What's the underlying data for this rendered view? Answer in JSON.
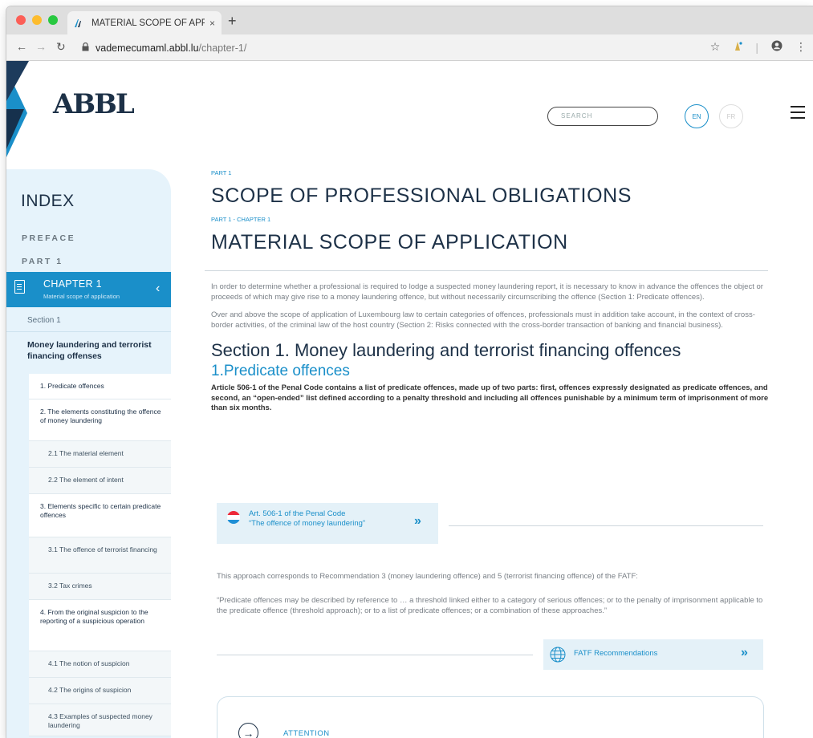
{
  "browser": {
    "tab_title": "MATERIAL SCOPE OF APPLICA",
    "tab_close": "×",
    "new_tab": "+",
    "url_host": "vademecumaml.abbl.lu",
    "url_path": "/chapter-1/"
  },
  "header": {
    "logo_text": "ABBL",
    "search_placeholder": "SEARCH",
    "lang_en": "EN",
    "lang_fr": "FR"
  },
  "sidebar": {
    "title": "INDEX",
    "preface": "PREFACE",
    "part": "PART 1",
    "chapter_title": "CHAPTER 1",
    "chapter_subtitle": "Material scope of application",
    "section_label": "Section 1",
    "section_title": "Money laundering and terrorist financing offenses",
    "items": [
      {
        "label": "1. Predicate offences",
        "level": 1
      },
      {
        "label": "2. The elements constituting the offence of money laundering",
        "level": 1
      },
      {
        "label": "2.1 The material element",
        "level": 2
      },
      {
        "label": "2.2 The element of intent",
        "level": 2
      },
      {
        "label": "3. Elements specific to certain predicate offences",
        "level": 1
      },
      {
        "label": "3.1 The offence of terrorist financing",
        "level": 2
      },
      {
        "label": "3.2 Tax crimes",
        "level": 2
      },
      {
        "label": "4. From the original suspicion to the reporting of a suspicious operation",
        "level": 1
      },
      {
        "label": "4.1 The notion of suspicion",
        "level": 2
      },
      {
        "label": "4.2 The origins of suspicion",
        "level": 2
      },
      {
        "label": "4.3 Examples of suspected money laundering",
        "level": 2
      }
    ]
  },
  "main": {
    "part_label": "PART 1",
    "part_title": "SCOPE OF PROFESSIONAL OBLIGATIONS",
    "chapter_label": "PART 1 - CHAPTER 1",
    "chapter_title": "MATERIAL SCOPE OF APPLICATION",
    "intro_1": "In order to determine whether a professional is required to lodge a suspected money laundering report, it is necessary to know in advance the offences the object or proceeds of which may give rise to a money laundering offence, but without necessarily circumscribing the offence (Section 1: Predicate offences).",
    "intro_2": "Over and above the scope of application of Luxembourg law to certain categories of offences, professionals must in addition take account, in the context of cross-border activities, of the criminal law of the host country (Section 2: Risks connected with the cross-border transaction of banking and financial business).",
    "section_title": "Section 1. Money laundering and terrorist financing offences",
    "subsection_title": "1.Predicate offences",
    "bold_text": "Article 506-1 of the Penal Code contains a list of predicate offences, made up of two parts: first, offences expressly designated as predicate offences, and second, an “open-ended” list defined according to a penalty threshold and including all offences punishable by a minimum term of imprisonment of more than six months.",
    "ref1_line1": "Art. 506-1 of the Penal Code",
    "ref1_line2": "“The offence of money laundering”",
    "approach_text": "This approach corresponds to Recommendation 3 (money laundering offence) and 5 (terrorist financing offence) of the FATF:",
    "quote_text": "“Predicate offences may be described by reference to … a threshold linked either to a category of serious offences; or to the penalty of imprisonment applicable to the predicate offence (threshold approach); or to a list of predicate offences; or a combination of these approaches.”",
    "ref2_label": "FATF Recommendations",
    "attention_label": "ATTENTION"
  }
}
